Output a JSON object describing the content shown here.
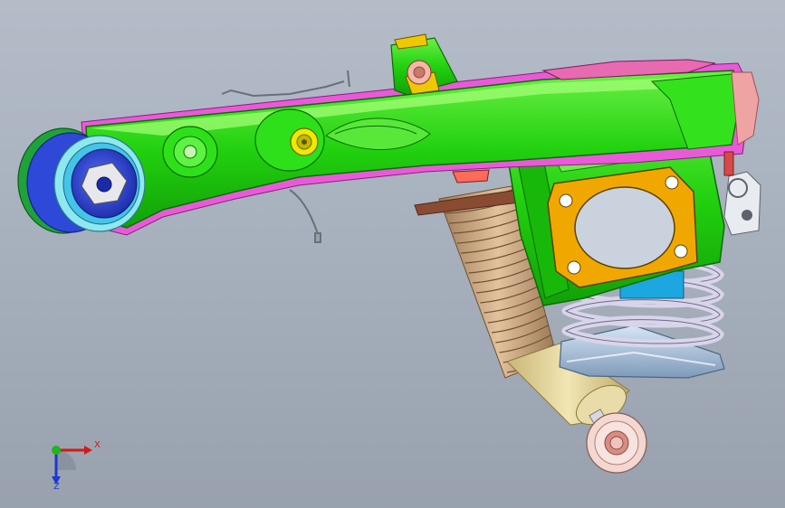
{
  "viewport": {
    "background_top": "#b4bcc8",
    "background_bottom": "#98a1ad"
  },
  "model": {
    "parts": [
      "control-arm",
      "bushing",
      "shock-absorber",
      "coil-spring",
      "knuckle-bracket",
      "mounting-flange",
      "spring-seat",
      "lower-eye",
      "top-clamp",
      "brake-line-clip"
    ],
    "colors": {
      "arm": "#22d10f",
      "arm_edge": "#0d6a05",
      "highlight": "#a8ff7a",
      "flange": "#f0a800",
      "bushing_outer": "#2e48d8",
      "spring": "#d8d4ea",
      "shock_body": "#e7d79a",
      "boot": "#c7a47e",
      "magenta_edge": "#e63cd0"
    }
  },
  "triad": {
    "x_label": "X",
    "z_label": "Z",
    "x_color": "#d11a1a",
    "y_color": "#1fb51f",
    "z_color": "#1a3ad1"
  }
}
